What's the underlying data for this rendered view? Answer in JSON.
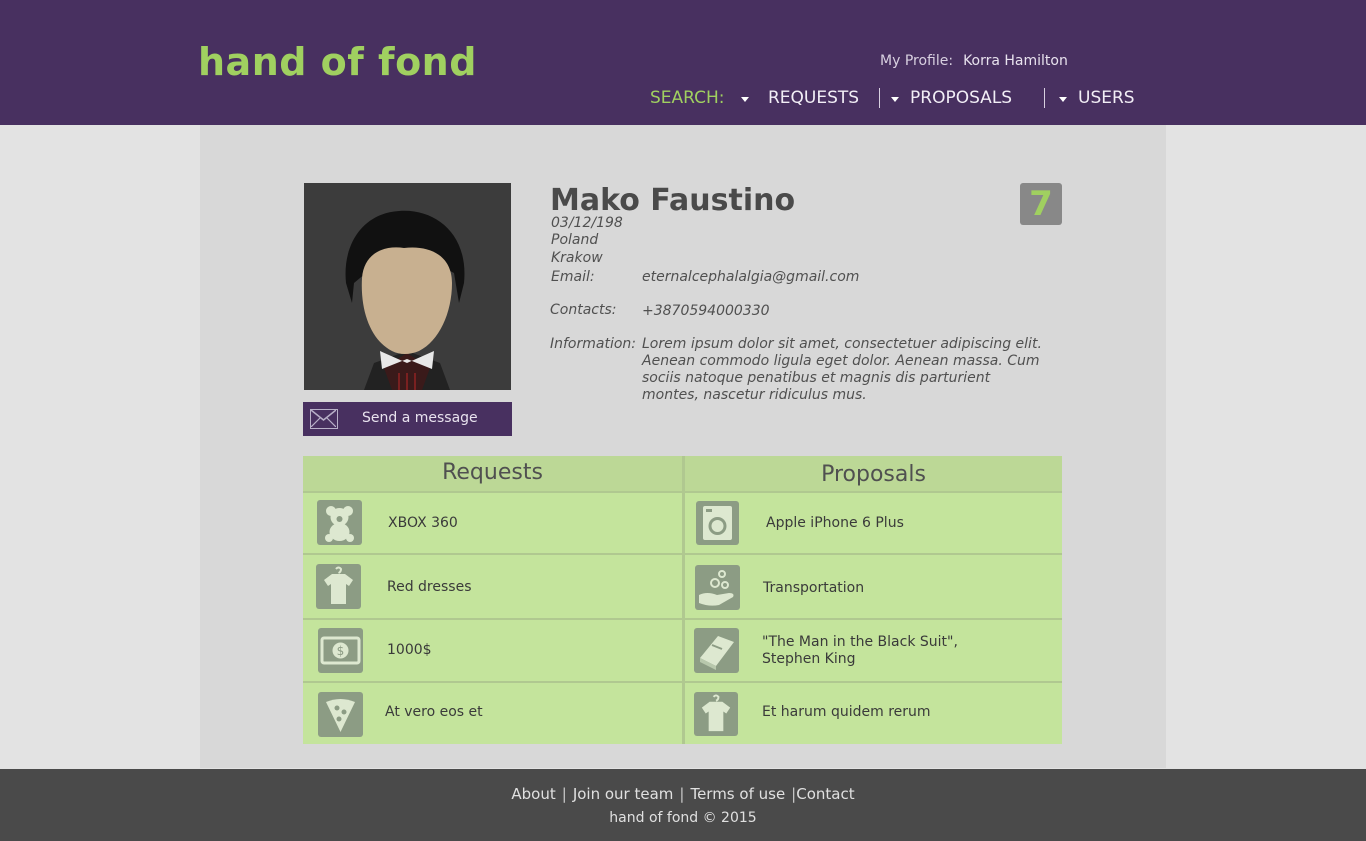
{
  "header": {
    "logo": "hand of fond",
    "profile_label": "My Profile:",
    "profile_name": "Korra Hamilton",
    "search_label": "SEARCH:",
    "nav": [
      "REQUESTS",
      "PROPOSALS",
      "USERS"
    ]
  },
  "profile": {
    "name": "Mako Faustino",
    "birth": "03/12/198",
    "country": "Poland",
    "city": "Krakow",
    "email_label": "Email:",
    "email": "eternalcephalalgia@gmail.com",
    "contacts_label": "Contacts:",
    "contacts": "+3870594000330",
    "information_label": "Information:",
    "information": "Lorem ipsum dolor sit amet, consectetuer adipiscing elit. Aenean commodo ligula eget dolor. Aenean massa. Cum sociis natoque penatibus et magnis dis parturient montes, nascetur ridiculus mus.",
    "score": "7",
    "send_message": "Send a message"
  },
  "table": {
    "requests_header": "Requests",
    "proposals_header": "Proposals",
    "requests": [
      {
        "icon": "teddy-bear-icon",
        "text": "XBOX 360"
      },
      {
        "icon": "tshirt-icon",
        "text": "Red dresses"
      },
      {
        "icon": "money-icon",
        "text": "1000$"
      },
      {
        "icon": "pizza-icon",
        "text": "At vero eos et"
      }
    ],
    "proposals": [
      {
        "icon": "washing-machine-icon",
        "text": "Apple iPhone 6 Plus"
      },
      {
        "icon": "hand-coins-icon",
        "text": "Transportation"
      },
      {
        "icon": "book-icon",
        "text": "\"The Man in the Black Suit\",",
        "text2": "Stephen King"
      },
      {
        "icon": "tshirt-icon",
        "text": "Et harum quidem rerum"
      }
    ]
  },
  "footer": {
    "links": [
      "About",
      "Join our team",
      "Terms of use",
      "Contact"
    ],
    "copyright": "hand of fond © 2015"
  },
  "colors": {
    "brand_purple": "#483060",
    "accent_green": "#a0d060",
    "table_green": "#c4e49c",
    "footer_gray": "#4a4a4a"
  }
}
